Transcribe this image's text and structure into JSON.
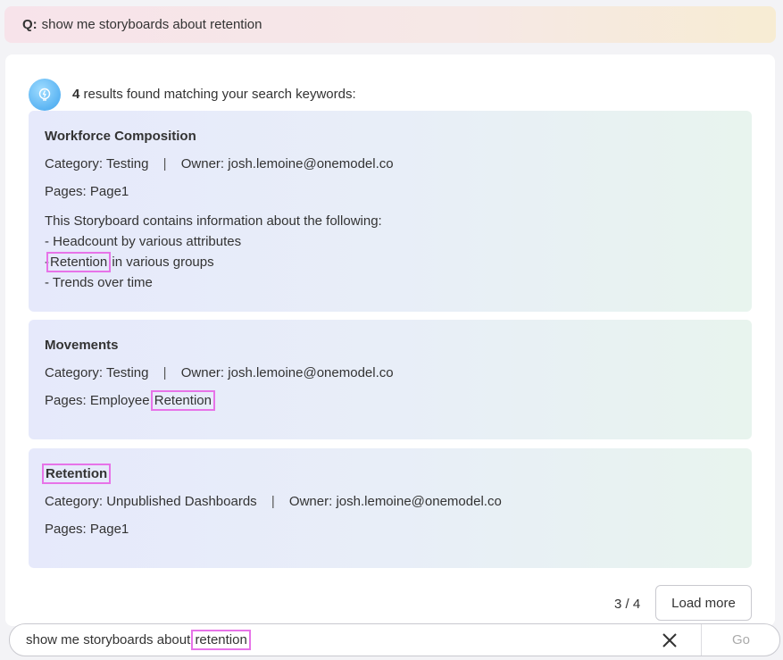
{
  "query": {
    "prefix": "Q:",
    "text": "show me storyboards about retention"
  },
  "summary": {
    "count": "4",
    "text": "results found matching your search keywords:"
  },
  "results": [
    {
      "title": "Workforce Composition",
      "category_label": "Category:",
      "category": "Testing",
      "separator": "|",
      "owner_label": "Owner:",
      "owner": "josh.lemoine@onemodel.co",
      "pages_label": "Pages:",
      "pages": "Page1",
      "description": {
        "intro": "This Storyboard contains information about the following:",
        "item1": "- Headcount by various attributes",
        "item2_prefix": "-",
        "item2_highlight": "Retention",
        "item2_suffix": "in various groups",
        "item3": "- Trends over time"
      }
    },
    {
      "title": "Movements",
      "category_label": "Category:",
      "category": "Testing",
      "separator": "|",
      "owner_label": "Owner:",
      "owner": "josh.lemoine@onemodel.co",
      "pages_label": "Pages:",
      "pages_prefix": "Employee",
      "pages_highlight": "Retention"
    },
    {
      "title": "Retention",
      "category_label": "Category:",
      "category": "Unpublished Dashboards",
      "separator": "|",
      "owner_label": "Owner:",
      "owner": "josh.lemoine@onemodel.co",
      "pages_label": "Pages:",
      "pages": "Page1"
    }
  ],
  "pager": {
    "text": "3 / 4"
  },
  "load_more_label": "Load more",
  "input": {
    "value_prefix": "show me storyboards about",
    "value_highlight": "retention",
    "go_label": "Go"
  },
  "colors": {
    "highlight": "#e773e8",
    "accent": "#5bb4f3"
  }
}
